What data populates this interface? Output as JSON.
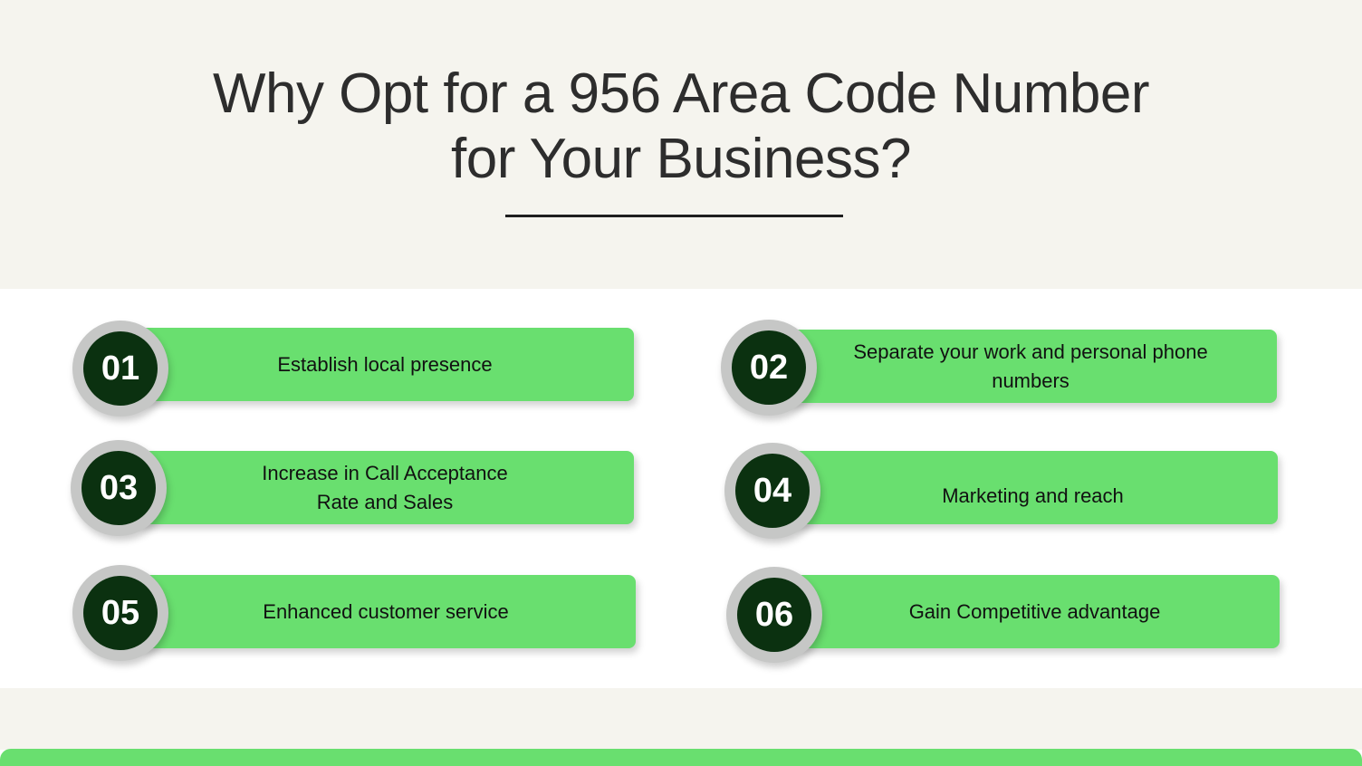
{
  "title": {
    "line1": "Why Opt for a 956 Area Code Number",
    "line2": "for Your Business?"
  },
  "items": [
    {
      "number": "01",
      "text": "Establish local presence"
    },
    {
      "number": "02",
      "text": "Separate your work and personal phone numbers"
    },
    {
      "number": "03",
      "text": "Increase in Call Acceptance Rate and Sales"
    },
    {
      "number": "04",
      "text": "Marketing and reach"
    },
    {
      "number": "05",
      "text": "Enhanced customer service"
    },
    {
      "number": "06",
      "text": "Gain Competitive advantage"
    }
  ],
  "colors": {
    "accent": "#69df6f",
    "badge": "#0b3110",
    "ring": "#c6c7c6",
    "background": "#f5f4ee"
  }
}
